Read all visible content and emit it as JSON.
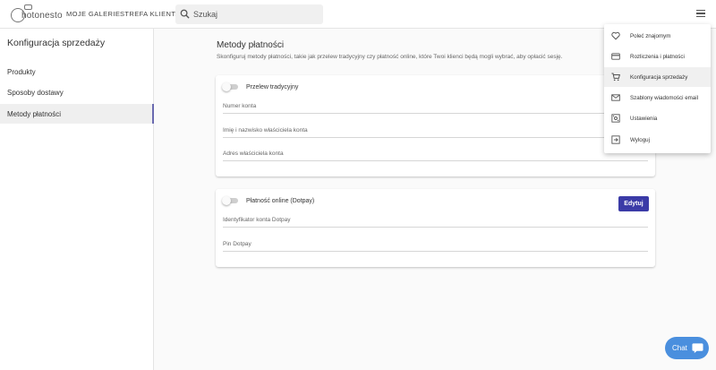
{
  "header": {
    "logo_text": "hotonesto",
    "nav": [
      "MOJE GALERIE",
      "STREFA KLIENTA"
    ],
    "search_placeholder": "Szukaj",
    "icons": {
      "search": "search-icon",
      "menu": "hamburger-menu-icon",
      "logo": "camera-logo-icon"
    }
  },
  "sidebar": {
    "title": "Konfiguracja sprzedaży",
    "items": [
      {
        "label": "Produkty",
        "active": false
      },
      {
        "label": "Sposoby dostawy",
        "active": false
      },
      {
        "label": "Metody płatności",
        "active": true
      }
    ],
    "active_color": "#6a6ab0"
  },
  "main": {
    "title": "Metody płatności",
    "description": "Skonfiguruj metody płatności, takie jak przelew tradycyjny czy płatność online, które Twoi klienci będą mogli wybrać, aby opłacić sesję.",
    "cards": [
      {
        "label": "Przelew tradycyjny",
        "enabled": false,
        "fields": [
          "Numer konta",
          "Imię i nazwisko właściciela konta",
          "Adres właściciela konta"
        ]
      },
      {
        "label": "Płatność online (Dotpay)",
        "enabled": false,
        "button": "Edytuj",
        "fields": [
          "Identyfikator konta Dotpay",
          "Pin Dotpay"
        ]
      }
    ]
  },
  "dropdown": {
    "items": [
      {
        "label": "Poleć znajomym",
        "icon": "heart-icon",
        "active": false
      },
      {
        "label": "Rozliczenia i płatności",
        "icon": "credit-card-icon",
        "active": false
      },
      {
        "label": "Konfiguracja sprzedaży",
        "icon": "shopping-cart-icon",
        "active": true
      },
      {
        "label": "Szablony wiadomości email",
        "icon": "email-icon",
        "active": false
      },
      {
        "label": "Ustawienia",
        "icon": "settings-icon",
        "active": false
      },
      {
        "label": "Wyloguj",
        "icon": "logout-icon",
        "active": false
      }
    ]
  },
  "chat": {
    "label": "Chat",
    "icon": "chat-bubble-icon",
    "color": "#4a8fde"
  },
  "colors": {
    "primary_button": "#3b3ba7"
  }
}
